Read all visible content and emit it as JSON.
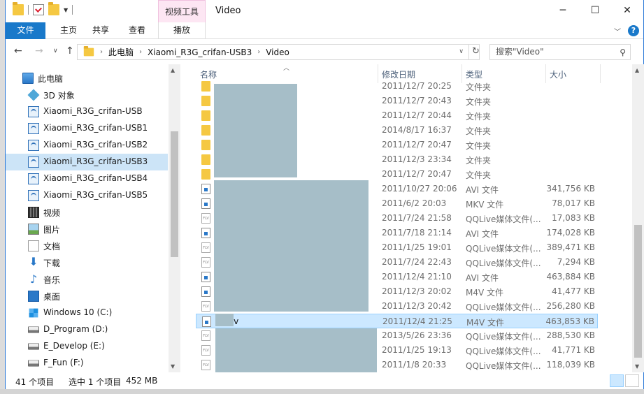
{
  "window": {
    "title": "Video",
    "contextual_tab_group": "视频工具",
    "minimize": "─",
    "maximize": "☐",
    "close": "✕"
  },
  "ribbon": {
    "tabs": [
      "文件",
      "主页",
      "共享",
      "查看",
      "播放"
    ]
  },
  "address": {
    "segments": [
      "此电脑",
      "Xiaomi_R3G_crifan-USB3",
      "Video"
    ],
    "search_placeholder": "搜索\"Video\""
  },
  "nav": {
    "items": [
      {
        "label": "此电脑",
        "icon": "pc-icon"
      },
      {
        "label": "3D 对象",
        "icon": "cube-icon"
      },
      {
        "label": "Xiaomi_R3G_crifan-USB",
        "icon": "network-drive-icon"
      },
      {
        "label": "Xiaomi_R3G_crifan-USB1",
        "icon": "network-drive-icon"
      },
      {
        "label": "Xiaomi_R3G_crifan-USB2",
        "icon": "network-drive-icon"
      },
      {
        "label": "Xiaomi_R3G_crifan-USB3",
        "icon": "network-drive-icon",
        "selected": true
      },
      {
        "label": "Xiaomi_R3G_crifan-USB4",
        "icon": "network-drive-icon"
      },
      {
        "label": "Xiaomi_R3G_crifan-USB5",
        "icon": "network-drive-icon"
      },
      {
        "label": "视频",
        "icon": "video-icon"
      },
      {
        "label": "图片",
        "icon": "picture-icon"
      },
      {
        "label": "文档",
        "icon": "document-icon"
      },
      {
        "label": "下载",
        "icon": "download-icon"
      },
      {
        "label": "音乐",
        "icon": "music-icon"
      },
      {
        "label": "桌面",
        "icon": "desktop-icon"
      },
      {
        "label": "Windows 10 (C:)",
        "icon": "windows-drive-icon"
      },
      {
        "label": "D_Program (D:)",
        "icon": "drive-icon"
      },
      {
        "label": "E_Develop (E:)",
        "icon": "drive-icon"
      },
      {
        "label": "F_Fun (F:)",
        "icon": "drive-icon"
      }
    ]
  },
  "columns": {
    "name": "名称",
    "date": "修改日期",
    "type": "类型",
    "size": "大小"
  },
  "files": [
    {
      "name": "",
      "date": "2011/12/7 20:25",
      "type": "文件夹",
      "size": "",
      "kind": "folder"
    },
    {
      "name": "",
      "date": "2011/12/7 20:43",
      "type": "文件夹",
      "size": "",
      "kind": "folder"
    },
    {
      "name": "",
      "date": "2011/12/7 20:44",
      "type": "文件夹",
      "size": "",
      "kind": "folder"
    },
    {
      "name": "",
      "date": "2014/8/17 16:37",
      "type": "文件夹",
      "size": "",
      "kind": "folder"
    },
    {
      "name": "",
      "date": "2011/12/7 20:47",
      "type": "文件夹",
      "size": "",
      "kind": "folder"
    },
    {
      "name": "",
      "date": "2011/12/3 23:34",
      "type": "文件夹",
      "size": "",
      "kind": "folder"
    },
    {
      "name": "",
      "date": "2011/12/7 20:47",
      "type": "文件夹",
      "size": "",
      "kind": "folder"
    },
    {
      "name": "",
      "date": "2011/10/27 20:06",
      "type": "AVI 文件",
      "size": "341,756 KB",
      "kind": "file"
    },
    {
      "name": "",
      "date": "2011/6/2 20:03",
      "type": "MKV 文件",
      "size": "78,017 KB",
      "kind": "file"
    },
    {
      "name": "",
      "date": "2011/7/24 21:58",
      "type": "QQLive媒体文件(...",
      "size": "17,083 KB",
      "kind": "flv"
    },
    {
      "name": "",
      "date": "2011/7/18 21:14",
      "type": "AVI 文件",
      "size": "174,028 KB",
      "kind": "file"
    },
    {
      "name": "",
      "date": "2011/1/25 19:01",
      "type": "QQLive媒体文件(...",
      "size": "389,471 KB",
      "kind": "flv"
    },
    {
      "name": "",
      "date": "2011/7/24 22:43",
      "type": "QQLive媒体文件(...",
      "size": "7,294 KB",
      "kind": "flv"
    },
    {
      "name": "",
      "date": "2011/12/4 21:10",
      "type": "AVI 文件",
      "size": "463,884 KB",
      "kind": "file"
    },
    {
      "name": "",
      "date": "2011/12/3 20:02",
      "type": "M4V 文件",
      "size": "41,477 KB",
      "kind": "file"
    },
    {
      "name": "",
      "date": "2011/12/3 20:42",
      "type": "QQLive媒体文件(...",
      "size": "256,280 KB",
      "kind": "flv"
    },
    {
      "name": ".m4v",
      "date": "2011/12/4 21:25",
      "type": "M4V 文件",
      "size": "463,853 KB",
      "kind": "file",
      "selected": true
    },
    {
      "name": "",
      "date": "2013/5/26 23:36",
      "type": "QQLive媒体文件(...",
      "size": "288,530 KB",
      "kind": "flv"
    },
    {
      "name": "",
      "date": "2011/1/25 19:13",
      "type": "QQLive媒体文件(...",
      "size": "41,771 KB",
      "kind": "flv"
    },
    {
      "name": "",
      "date": "2011/1/8 20:33",
      "type": "QQLive媒体文件(...",
      "size": "118,039 KB",
      "kind": "flv"
    }
  ],
  "status": {
    "count": "41 个项目",
    "selection": "选中 1 个项目",
    "size": "452 MB"
  }
}
